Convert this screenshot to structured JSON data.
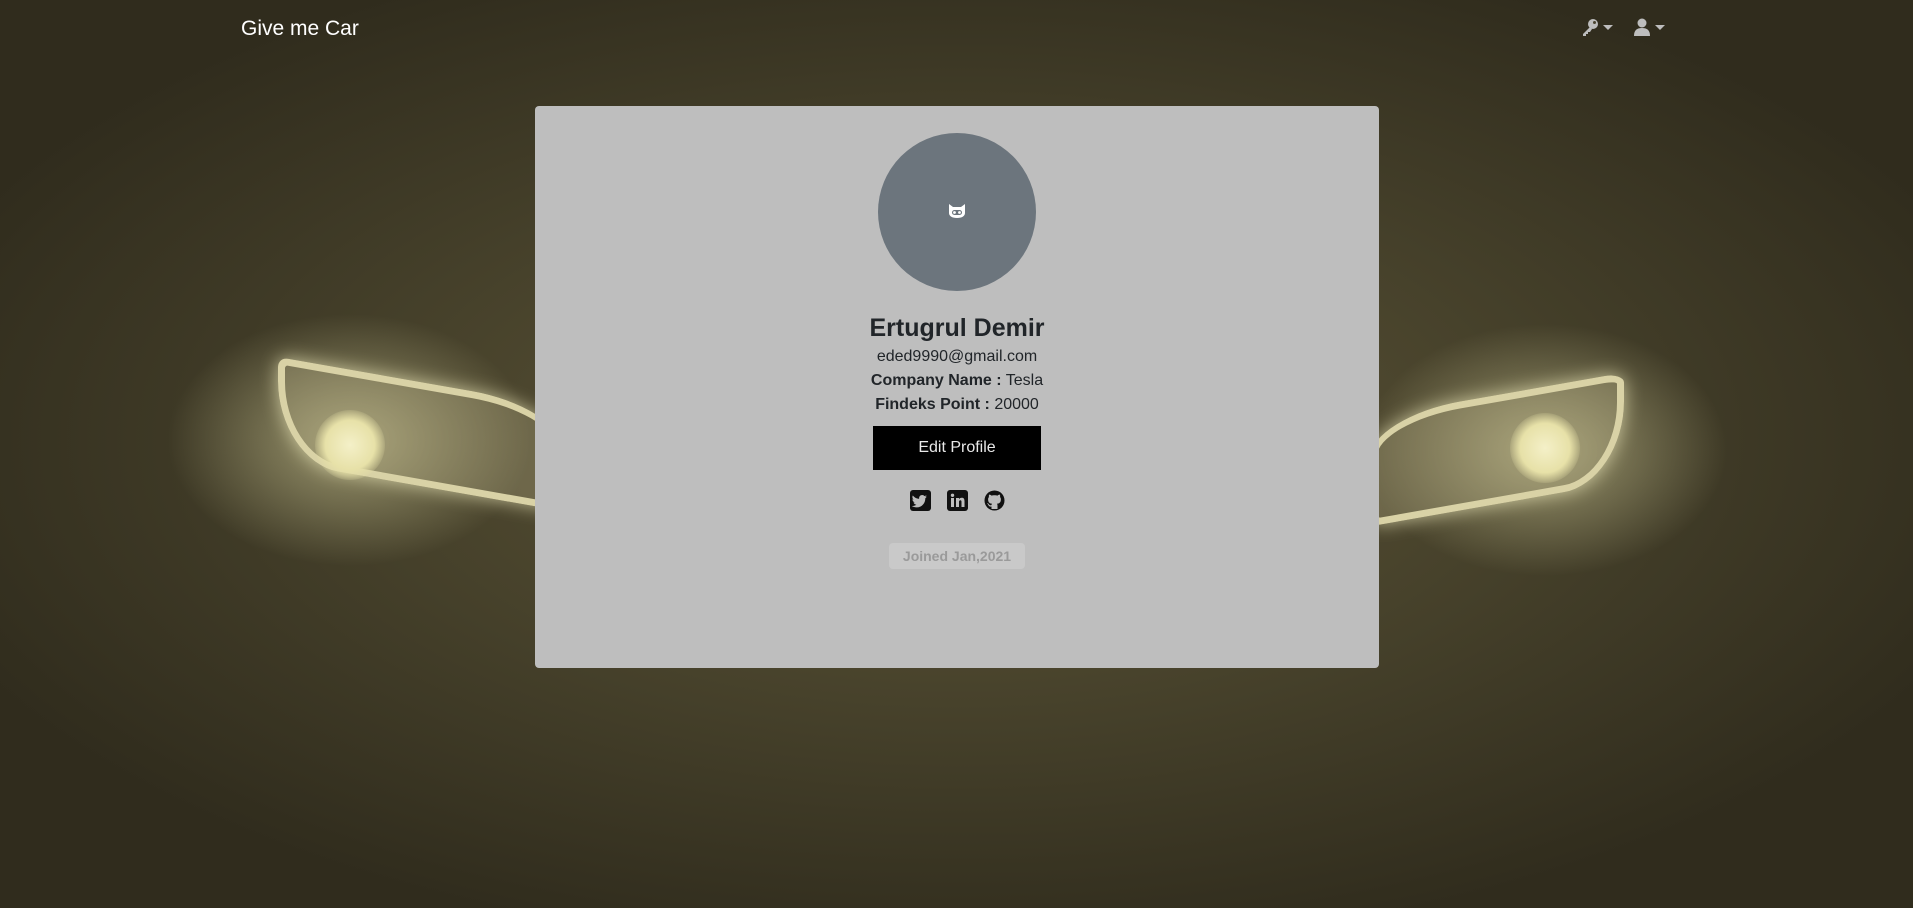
{
  "navbar": {
    "brand": "Give me Car",
    "icons": [
      "key-icon",
      "user-icon"
    ]
  },
  "profile": {
    "avatar_icon": "robot-face-icon",
    "name": "Ertugrul Demir",
    "email": "eded9990@gmail.com",
    "company_label": "Company Name :",
    "company_value": "Tesla",
    "findeks_label": "Findeks Point :",
    "findeks_value": "20000",
    "edit_button": "Edit Profile",
    "socials": [
      "twitter-icon",
      "linkedin-icon",
      "github-icon"
    ],
    "joined": "Joined Jan,2021"
  },
  "colors": {
    "card_bg": "#bebebe",
    "avatar_bg": "#6c757d",
    "button_bg": "#000000"
  }
}
